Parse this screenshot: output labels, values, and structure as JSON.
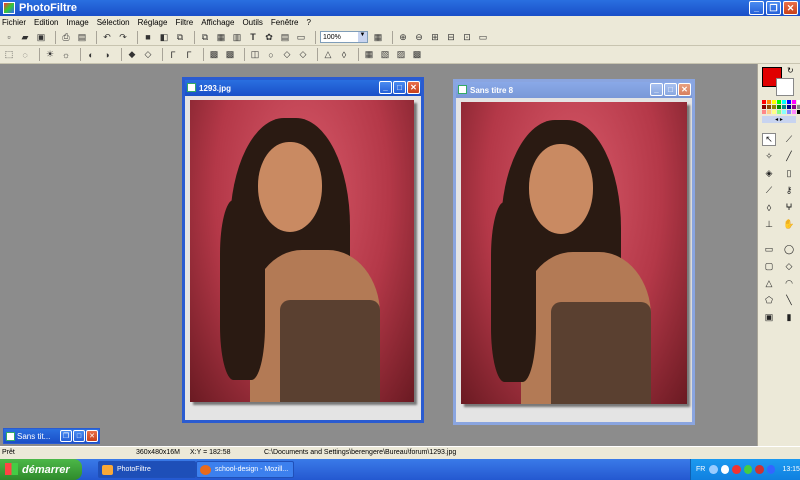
{
  "app": {
    "title": "PhotoFiltre"
  },
  "menu": [
    "Fichier",
    "Edition",
    "Image",
    "Sélection",
    "Réglage",
    "Filtre",
    "Affichage",
    "Outils",
    "Fenêtre",
    "?"
  ],
  "toolbar": {
    "zoom_value": "100%"
  },
  "documents": [
    {
      "title": "1293.jpg",
      "active": true
    },
    {
      "title": "Sans titre 8",
      "active": false
    }
  ],
  "minimized_doc": {
    "title": "Sans tit..."
  },
  "status": {
    "state": "Prêt",
    "size": "360x480x16M",
    "coords": "X:Y = 182:58",
    "path": "C:\\Documents and Settings\\berengere\\Bureau\\forum\\1293.jpg"
  },
  "taskbar": {
    "start_label": "démarrer",
    "tasks": [
      {
        "label": "PhotoFiltre",
        "active": true
      },
      {
        "label": "school-design - Mozill...",
        "active": false
      }
    ],
    "lang": "FR",
    "clock": "13:15"
  },
  "colors": {
    "foreground": "#e00000",
    "background": "#ffffff",
    "title_blue": "#2a6fe0",
    "photo_bg": "#b43848"
  }
}
